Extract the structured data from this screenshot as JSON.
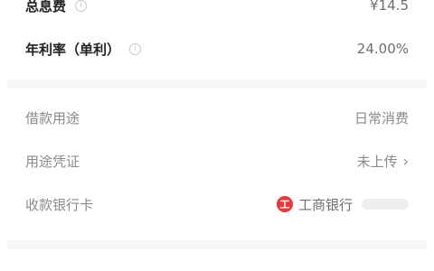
{
  "summary": {
    "total_interest": {
      "label": "总息费",
      "value": "¥14.5"
    },
    "annual_rate": {
      "label": "年利率（单利）",
      "value": "24.00%"
    }
  },
  "details": {
    "purpose": {
      "label": "借款用途",
      "value": "日常消费"
    },
    "voucher": {
      "label": "用途凭证",
      "value": "未上传"
    },
    "bank_card": {
      "label": "收款银行卡",
      "bank_name": "工商银行"
    }
  },
  "icons": {
    "info": "info-icon",
    "chevron": "chevron-right-icon",
    "bank": "icbc-logo"
  }
}
